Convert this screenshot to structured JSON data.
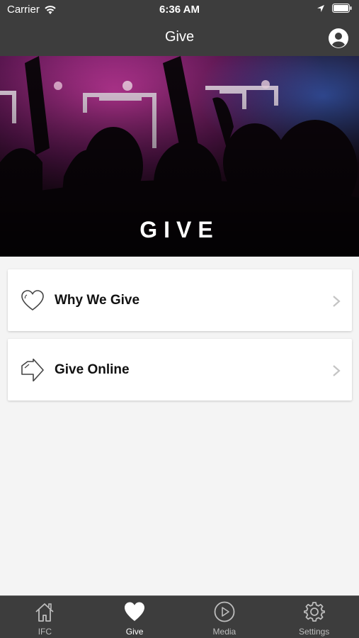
{
  "status_bar": {
    "carrier": "Carrier",
    "time": "6:36 AM"
  },
  "nav": {
    "title": "Give"
  },
  "hero": {
    "title": "GIVE"
  },
  "cards": [
    {
      "label": "Why We Give",
      "icon": "heart-outline-icon"
    },
    {
      "label": "Give Online",
      "icon": "arrow-right-outline-icon"
    }
  ],
  "tabs": [
    {
      "label": "IFC",
      "icon": "home-icon",
      "active": false
    },
    {
      "label": "Give",
      "icon": "heart-filled-icon",
      "active": true
    },
    {
      "label": "Media",
      "icon": "play-circle-icon",
      "active": false
    },
    {
      "label": "Settings",
      "icon": "gear-icon",
      "active": false
    }
  ],
  "colors": {
    "bar": "#3d3d3d",
    "background": "#f4f4f4",
    "active_tab": "#ffffff",
    "inactive_tab": "#bdbdbd"
  }
}
